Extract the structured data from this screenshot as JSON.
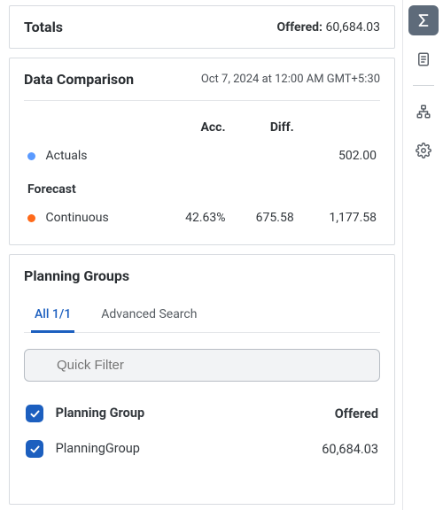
{
  "totals": {
    "title": "Totals",
    "offered_label": "Offered:",
    "offered_value": "60,684.03"
  },
  "comparison": {
    "title": "Data Comparison",
    "timestamp": "Oct 7, 2024 at 12:00 AM GMT+5:30",
    "col_acc": "Acc.",
    "col_diff": "Diff.",
    "actuals_label": "Actuals",
    "actuals_value": "502.00",
    "forecast_label": "Forecast",
    "continuous_label": "Continuous",
    "continuous_acc": "42.63%",
    "continuous_diff": "675.58",
    "continuous_value": "1,177.58"
  },
  "planning": {
    "title": "Planning Groups",
    "tabs": {
      "all": "All 1/1",
      "advanced": "Advanced Search"
    },
    "filter_placeholder": "Quick Filter",
    "col_name": "Planning Group",
    "col_offered": "Offered",
    "row_name": "PlanningGroup",
    "row_offered": "60,684.03"
  }
}
